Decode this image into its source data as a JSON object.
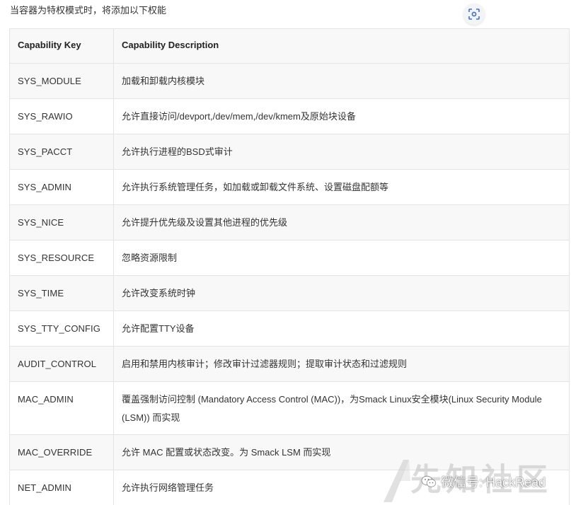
{
  "intro": "当容器为特权模式时，将添加以下权能",
  "table": {
    "headers": [
      "Capability Key",
      "Capability Description"
    ],
    "rows": [
      {
        "key": "SYS_MODULE",
        "desc": "加载和卸载内核模块"
      },
      {
        "key": "SYS_RAWIO",
        "desc": "允许直接访问/devport,/dev/mem,/dev/kmem及原始块设备"
      },
      {
        "key": "SYS_PACCT",
        "desc": "允许执行进程的BSD式审计"
      },
      {
        "key": "SYS_ADMIN",
        "desc": "允许执行系统管理任务，如加载或卸载文件系统、设置磁盘配额等"
      },
      {
        "key": "SYS_NICE",
        "desc": "允许提升优先级及设置其他进程的优先级"
      },
      {
        "key": "SYS_RESOURCE",
        "desc": "忽略资源限制"
      },
      {
        "key": "SYS_TIME",
        "desc": "允许改变系统时钟"
      },
      {
        "key": "SYS_TTY_CONFIG",
        "desc": "允许配置TTY设备"
      },
      {
        "key": "AUDIT_CONTROL",
        "desc": "启用和禁用内核审计；修改审计过滤器规则；提取审计状态和过滤规则"
      },
      {
        "key": "MAC_ADMIN",
        "desc": "覆盖强制访问控制 (Mandatory Access Control (MAC))，为Smack Linux安全模块(Linux Security Module (LSM)) 而实现"
      },
      {
        "key": "MAC_OVERRIDE",
        "desc": "允许 MAC 配置或状态改变。为 Smack LSM 而实现"
      },
      {
        "key": "NET_ADMIN",
        "desc": "允许执行网络管理任务"
      }
    ]
  },
  "watermark": {
    "site": "先知社区",
    "account": "微信号: HackRead"
  },
  "icons": {
    "scan": "scan-icon",
    "wechat": "wechat-icon"
  }
}
